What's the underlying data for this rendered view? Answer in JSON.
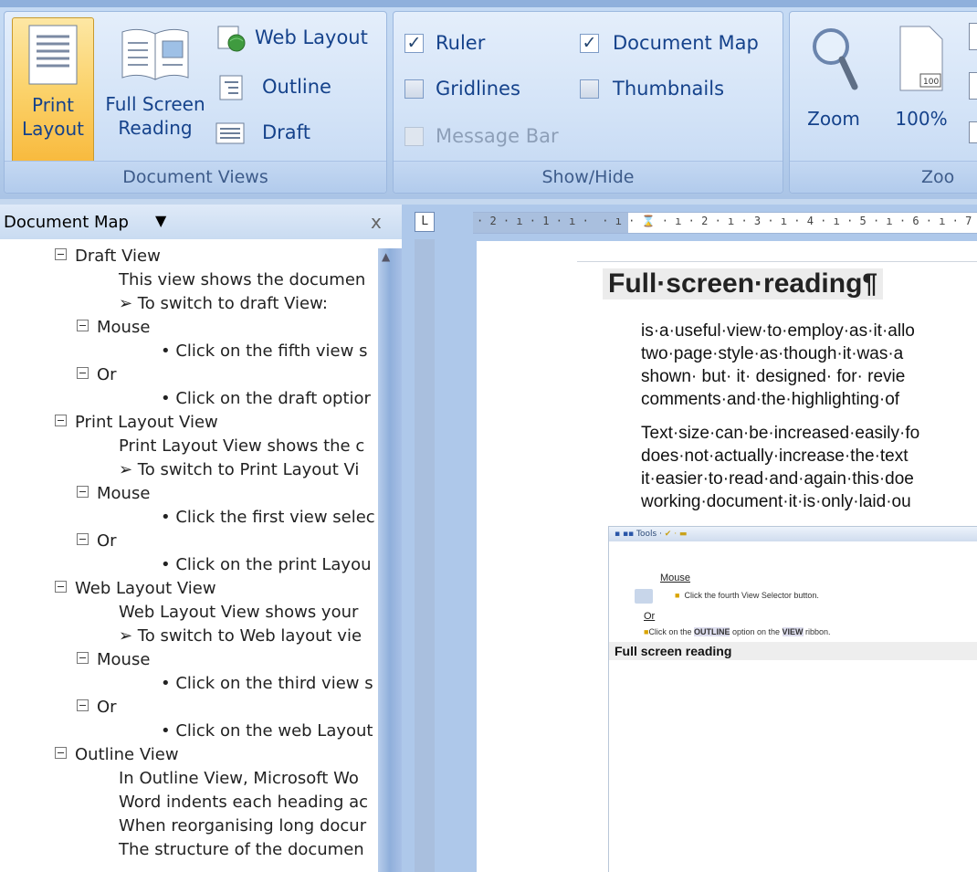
{
  "ribbon": {
    "document_views": {
      "group_label": "Document Views",
      "print_layout_label": [
        "Print",
        "Layout"
      ],
      "full_screen_reading_label": [
        "Full Screen",
        "Reading"
      ],
      "web_layout_label": "Web Layout",
      "outline_label": "Outline",
      "draft_label": "Draft",
      "active_view": "Print Layout"
    },
    "show_hide": {
      "group_label": "Show/Hide",
      "ruler": {
        "label": "Ruler",
        "checked": true
      },
      "gridlines": {
        "label": "Gridlines",
        "checked": false
      },
      "message_bar": {
        "label": "Message Bar",
        "checked": false,
        "disabled": true
      },
      "document_map": {
        "label": "Document Map",
        "checked": true
      },
      "thumbnails": {
        "label": "Thumbnails",
        "checked": false
      }
    },
    "zoom": {
      "group_label": "Zoo",
      "zoom_label": "Zoom",
      "hundred_label": "100%",
      "hundred_icon_text": "100"
    }
  },
  "document_map": {
    "title": "Document Map",
    "dropdown_glyph": "▼",
    "close_glyph": "x",
    "items": [
      {
        "text": "Draft View",
        "collapsible": true
      },
      {
        "text": "This view shows the documen",
        "collapsible": false
      },
      {
        "text": "➢ To switch to draft View:",
        "collapsible": false
      },
      {
        "text": "Mouse",
        "collapsible": true
      },
      {
        "text": "• Click on the fifth view s",
        "collapsible": false
      },
      {
        "text": "Or",
        "collapsible": true
      },
      {
        "text": "• Click on the draft optior",
        "collapsible": false
      },
      {
        "text": "Print Layout View",
        "collapsible": true
      },
      {
        "text": "Print Layout View shows the c",
        "collapsible": false
      },
      {
        "text": "➢ To switch to Print Layout Vi",
        "collapsible": false
      },
      {
        "text": "Mouse",
        "collapsible": true
      },
      {
        "text": "• Click the first view selec",
        "collapsible": false
      },
      {
        "text": "Or",
        "collapsible": true
      },
      {
        "text": "• Click on the print Layou",
        "collapsible": false
      },
      {
        "text": "Web Layout View",
        "collapsible": true
      },
      {
        "text": "Web Layout View shows your",
        "collapsible": false
      },
      {
        "text": "➢ To switch to Web layout vie",
        "collapsible": false
      },
      {
        "text": "Mouse",
        "collapsible": true
      },
      {
        "text": "• Click on the third view s",
        "collapsible": false
      },
      {
        "text": "Or",
        "collapsible": true
      },
      {
        "text": "• Click on the web Layout",
        "collapsible": false
      },
      {
        "text": "Outline View",
        "collapsible": true
      },
      {
        "text": "In Outline View, Microsoft Wo",
        "collapsible": false
      },
      {
        "text": "Word indents each heading ac",
        "collapsible": false
      },
      {
        "text": "When reorganising long docur",
        "collapsible": false
      },
      {
        "text": "The structure of the documen",
        "collapsible": false
      }
    ]
  },
  "document": {
    "ruler_corner_glyph": "L",
    "ruler_text": "· 2 · ı · 1 · ı ·  · ı · ⌛ · ı · 2 · ı · 3 · ı · 4 · ı · 5 · ı · 6 · ı · 7",
    "heading": "Full·screen·reading¶",
    "para1": [
      "is·a·useful·view·to·employ·as·it·allo",
      "two·page·style·as·though·it·was·a",
      "shown· but· it· designed· for· revie",
      "comments·and·the·highlighting·of"
    ],
    "para2": [
      "Text·size·can·be·increased·easily·fo",
      "does·not·actually·increase·the·text",
      "it·easier·to·read·and·again·this·doe",
      "working·document·it·is·only·laid·ou"
    ],
    "embedded_screenshot": {
      "toolbar_text": "Tools ·",
      "mouse_link": "Mouse",
      "bullet1": "Click the fourth View Selector button.",
      "or_link": "Or",
      "bullet2_pre": "Click on the ",
      "bullet2_b1": "OUTLINE",
      "bullet2_mid": " option on the ",
      "bullet2_b2": "VIEW",
      "bullet2_post": " ribbon.",
      "heading": "Full screen reading"
    }
  }
}
